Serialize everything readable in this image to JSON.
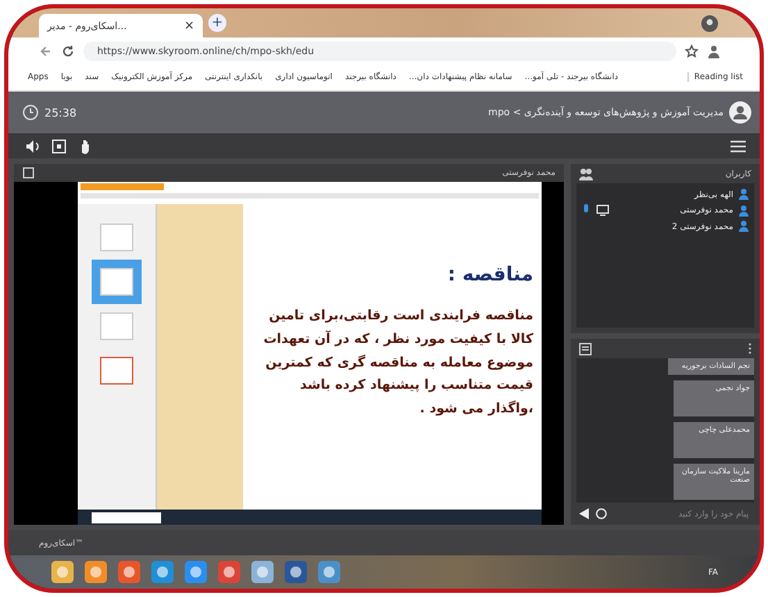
{
  "browser": {
    "tab_title": "اسکای‌روم - مدیر...",
    "tab_close": "×",
    "new_tab": "+",
    "url": "https://www.skyroom.online/ch/mpo-skh/edu",
    "reading_list": "Reading list",
    "bookmarks": [
      {
        "label": "دانشگاه بیرجند - تلی آمو..."
      },
      {
        "label": "سامانه نظام پیشنهادات دان..."
      },
      {
        "label": "دانشگاه بیرجند"
      },
      {
        "label": "اتوماسیون اداری"
      },
      {
        "label": "بانکداری اینترنتی"
      },
      {
        "label": "مرکز آموزش الکترونیک"
      },
      {
        "label": "سند"
      },
      {
        "label": "بویا"
      },
      {
        "label": "Apps"
      }
    ]
  },
  "app": {
    "timer": "25:38",
    "room_title": "mpo < مدیریت آموزش و پژوهش‌های توسعه و آینده‌نگری",
    "presenter": "محمد نوفرستی",
    "footer": "اسکای‌روم™"
  },
  "users": {
    "title": "کاربران",
    "items": [
      {
        "name": "الهه بی‌نظر",
        "presenting": false
      },
      {
        "name": "محمد نوفرستی",
        "presenting": true
      },
      {
        "name": "محمد نوفرستی 2",
        "presenting": false
      }
    ]
  },
  "chat": {
    "placeholder": "پیام خود را وارد کنید",
    "messages": [
      {
        "sender": "نجم السادات برجوریه"
      },
      {
        "sender": "جواد نجمی"
      },
      {
        "sender": "محمدعلی چاچی"
      },
      {
        "sender": "مارینا ملاکیت سازمان صنعت"
      }
    ]
  },
  "slide": {
    "heading": "مناقصه :",
    "body": "مناقصه فرایندی است رقابتی،برای تامین کالا با کیفیت مورد نظر ، که در آن تعهدات موضوع معامله به مناقصه گری که کمترین قیمت متناسب را پیشنهاد کرده باشد ،واگذار می شود ."
  },
  "taskbar": {
    "language": "FA"
  }
}
